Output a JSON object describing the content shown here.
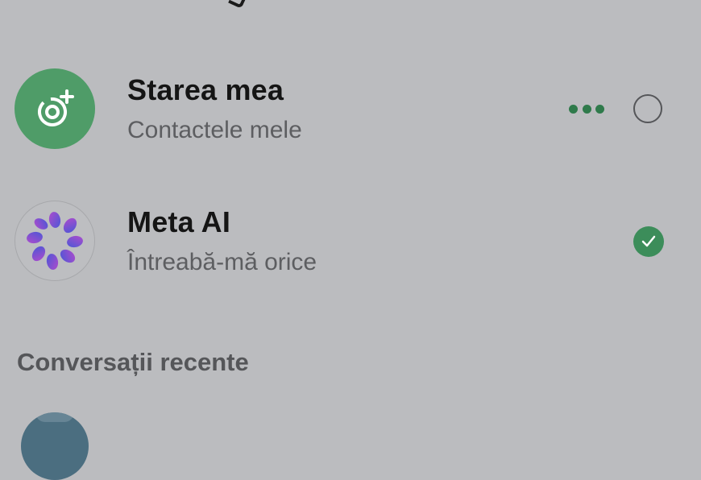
{
  "rows": [
    {
      "title": "Starea mea",
      "subtitle": "Contactele mele",
      "avatar_icon": "status-camera-plus-icon",
      "has_more": true,
      "selected": false
    },
    {
      "title": "Meta AI",
      "subtitle": "Întreabă-mă orice",
      "avatar_icon": "meta-ai-ring-icon",
      "has_more": false,
      "selected": true
    }
  ],
  "recent_section": {
    "header": "Conversații recente"
  },
  "colors": {
    "background": "#bbbcbf",
    "accent_green": "#3c8d5a",
    "status_avatar": "#4f9c68",
    "more_dots": "#2f7a4b"
  }
}
